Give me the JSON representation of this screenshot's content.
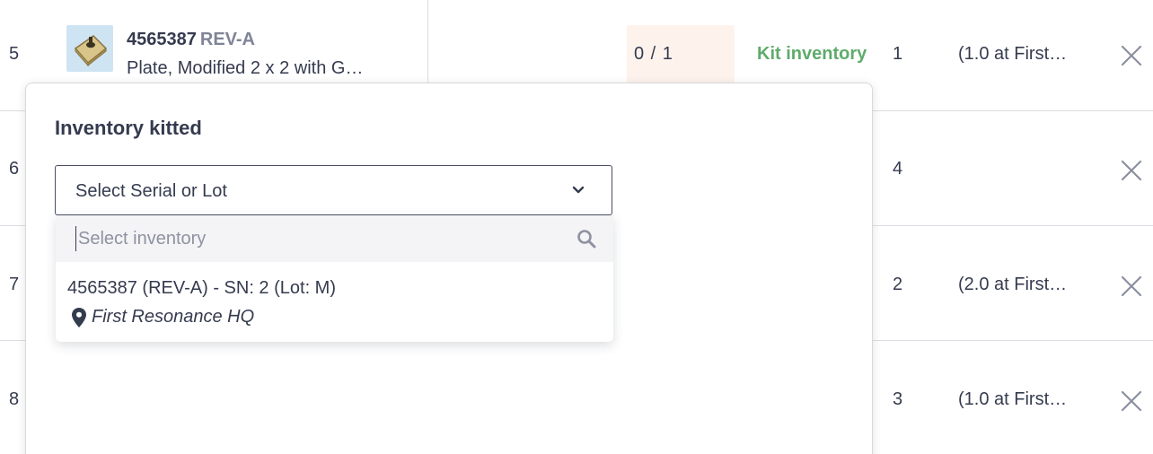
{
  "rows": [
    {
      "num": "5",
      "quantity": "1",
      "location": "(1.0 at First…"
    },
    {
      "num": "6",
      "quantity": "4",
      "location": ""
    },
    {
      "num": "7",
      "quantity": "2",
      "location": "(2.0 at First…"
    },
    {
      "num": "8",
      "quantity": "3",
      "location": "(1.0 at First…"
    }
  ],
  "part": {
    "number": "4565387",
    "revision": "REV-A",
    "description": "Plate, Modified 2 x 2 with G…"
  },
  "kitted_count": "0 / 1",
  "kit_inventory_label": "Kit inventory",
  "popover": {
    "title": "Inventory kitted",
    "select_value": "Select Serial or Lot",
    "search_placeholder": "Select inventory",
    "options": [
      {
        "label": "4565387 (REV-A) - SN: 2 (Lot: M)",
        "location": "First Resonance HQ"
      }
    ]
  },
  "icons": {
    "remove": "close-icon",
    "dropdown": "chevron-down-icon",
    "search": "search-icon",
    "location": "map-pin-icon"
  },
  "colors": {
    "text": "#353b4f",
    "muted": "#7f8496",
    "kit_link": "#5fab6b",
    "kitted_bg": "#fdf3ec",
    "thumb_bg": "#cfe4f3",
    "divider": "#dcdde2"
  }
}
